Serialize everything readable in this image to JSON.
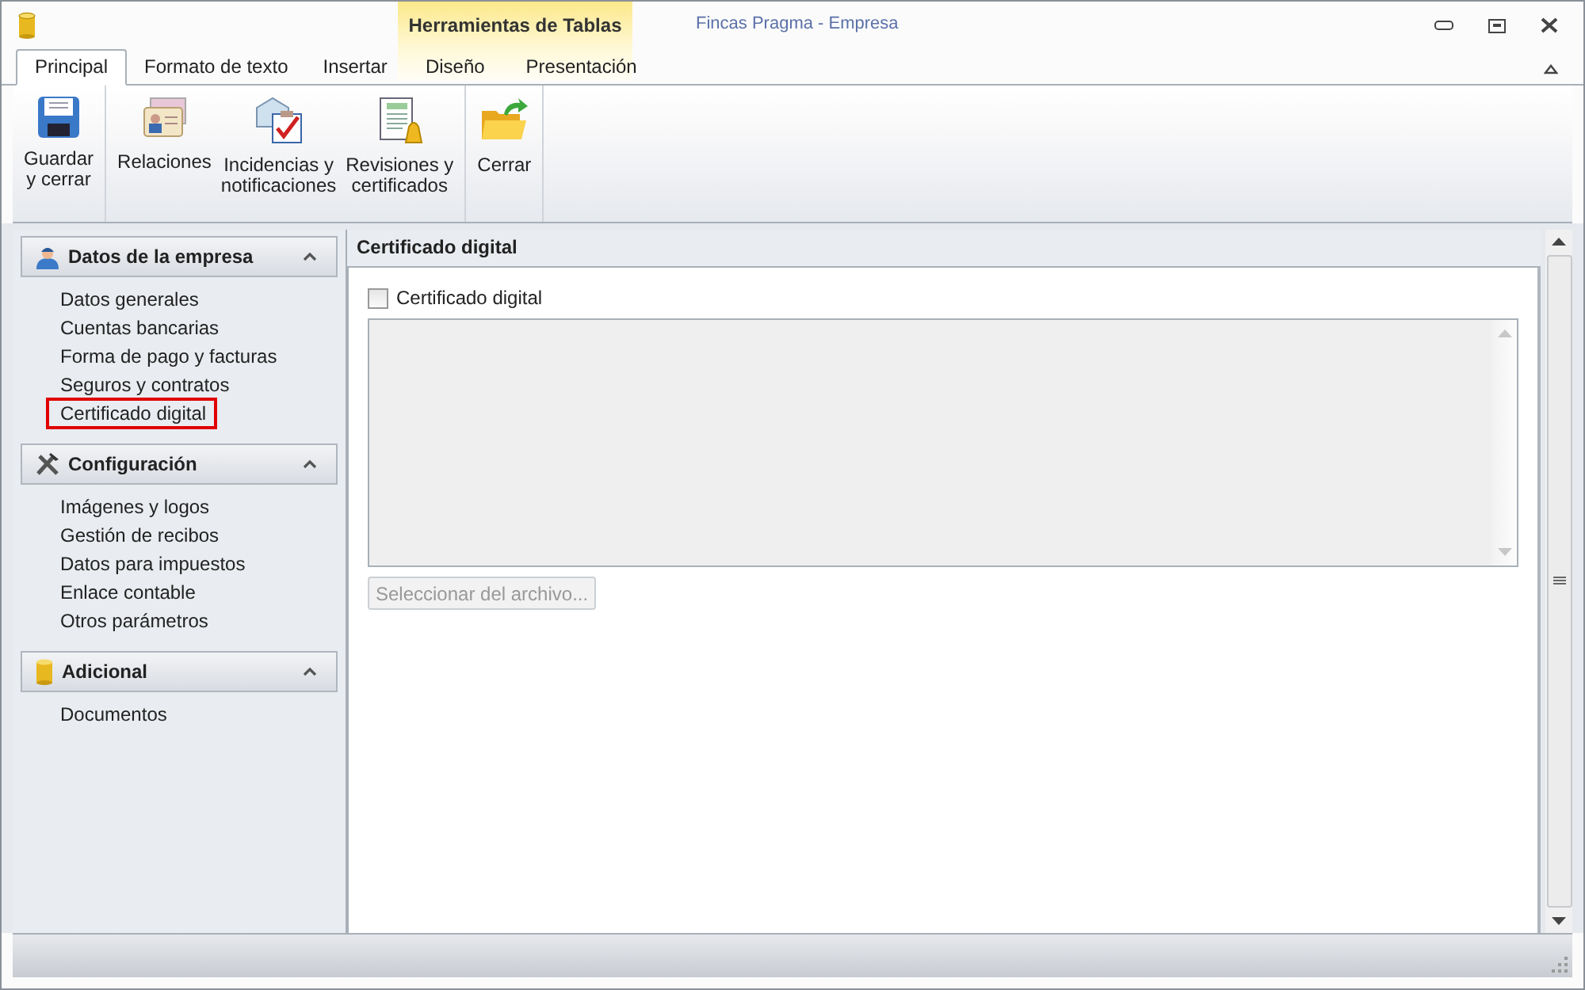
{
  "window": {
    "title": "Fincas Pragma - Empresa",
    "context_tab_group": "Herramientas de Tablas"
  },
  "tabs": [
    {
      "label": "Principal",
      "selected": true,
      "contextual": false
    },
    {
      "label": "Formato de texto",
      "selected": false,
      "contextual": false
    },
    {
      "label": "Insertar",
      "selected": false,
      "contextual": false
    },
    {
      "label": "Diseño",
      "selected": false,
      "contextual": true
    },
    {
      "label": "Presentación",
      "selected": false,
      "contextual": true
    }
  ],
  "ribbon_groups": [
    [
      {
        "kind": "save",
        "label": "Guardar\ny cerrar"
      }
    ],
    [
      {
        "kind": "card",
        "label": "Relaciones"
      },
      {
        "kind": "mail",
        "label": "Incidencias y\nnotificaciones"
      },
      {
        "kind": "bell",
        "label": "Revisiones y\ncertificados"
      }
    ],
    [
      {
        "kind": "folder",
        "label": "Cerrar"
      }
    ]
  ],
  "sidebar": [
    {
      "kind": "person",
      "title": "Datos de la empresa",
      "expanded": true,
      "items": [
        {
          "label": "Datos generales",
          "highlighted": false
        },
        {
          "label": "Cuentas bancarias",
          "highlighted": false
        },
        {
          "label": "Forma de pago y facturas",
          "highlighted": false
        },
        {
          "label": "Seguros y contratos",
          "highlighted": false
        },
        {
          "label": "Certificado digital",
          "highlighted": true
        }
      ]
    },
    {
      "kind": "tools",
      "title": "Configuración",
      "expanded": true,
      "items": [
        {
          "label": "Imágenes y logos",
          "highlighted": false
        },
        {
          "label": "Gestión de recibos",
          "highlighted": false
        },
        {
          "label": "Datos para impuestos",
          "highlighted": false
        },
        {
          "label": "Enlace contable",
          "highlighted": false
        },
        {
          "label": "Otros parámetros",
          "highlighted": false
        }
      ]
    },
    {
      "kind": "db",
      "title": "Adicional",
      "expanded": true,
      "items": [
        {
          "label": "Documentos",
          "highlighted": false
        }
      ]
    }
  ],
  "content": {
    "title": "Certificado digital",
    "checkbox": {
      "label": "Certificado digital",
      "checked": false
    },
    "select_button": {
      "label": "Seleccionar del archivo...",
      "disabled": true
    }
  }
}
